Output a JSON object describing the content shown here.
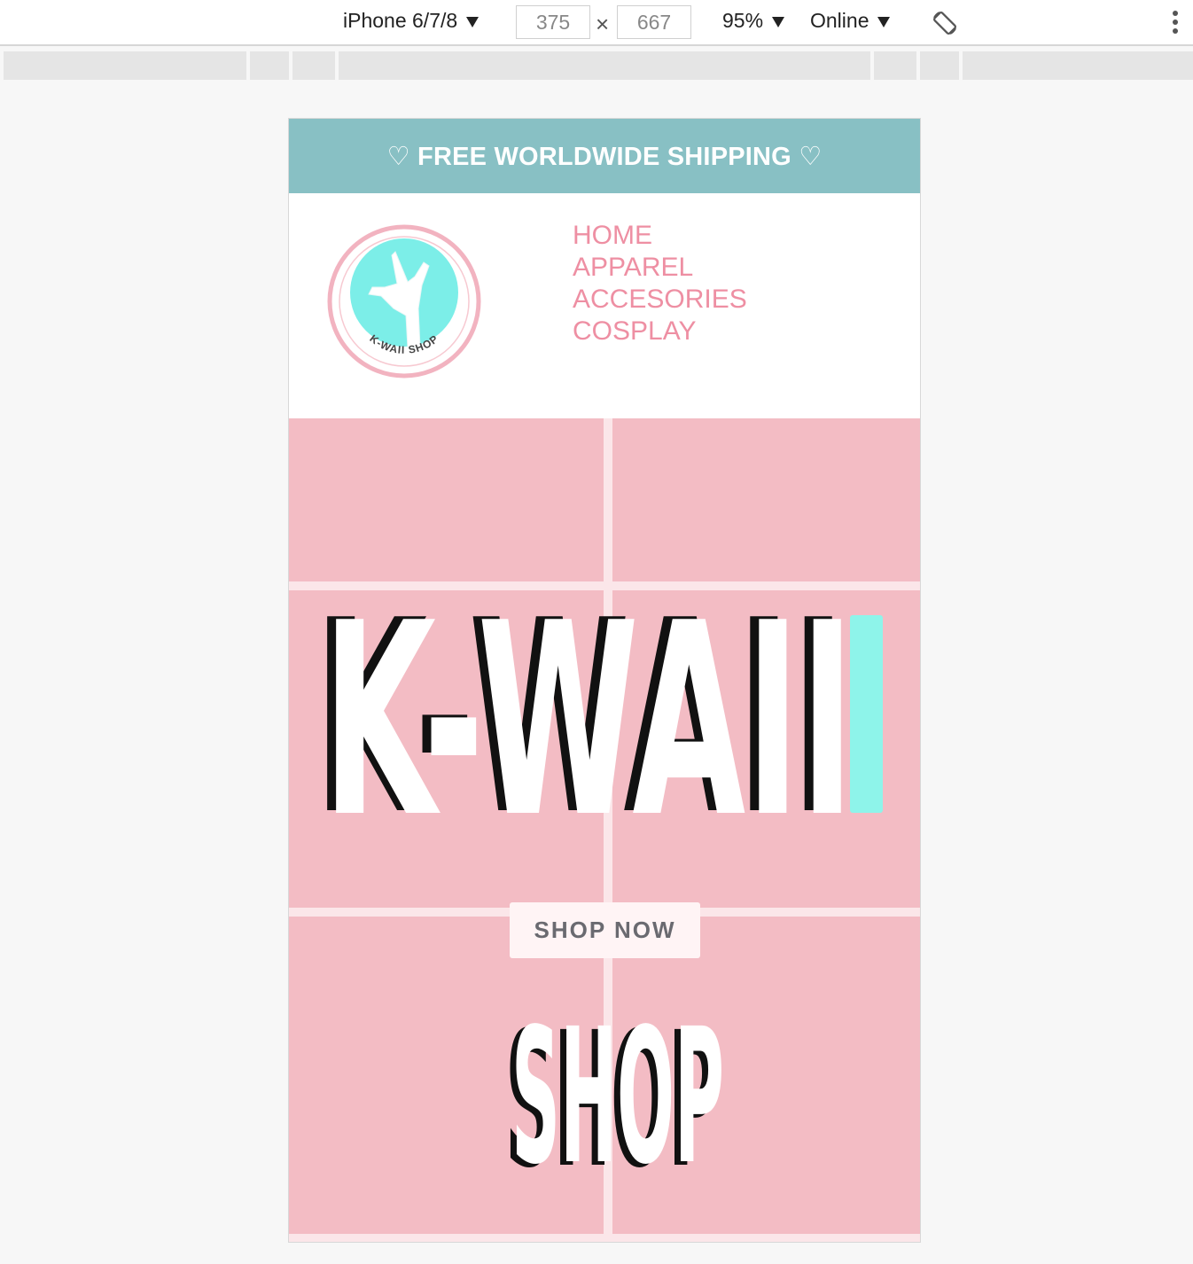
{
  "devtools": {
    "device": "iPhone 6/7/8",
    "width": "375",
    "height": "667",
    "times": "×",
    "zoom": "95%",
    "network": "Online"
  },
  "site": {
    "banner": "♡ FREE WORLDWIDE SHIPPING ♡",
    "logo_text": "K-WAII SHOP",
    "nav": [
      "HOME",
      "APPAREL",
      "ACCESORIES",
      "COSPLAY"
    ],
    "hero_title": "K-WAII",
    "hero_subtitle": "SHOP",
    "cta": "SHOP NOW"
  },
  "colors": {
    "banner": "#88c0c4",
    "nav_text": "#ee8fa3",
    "hero_bg": "#f3bcc4",
    "accent_mint": "#8ef4ea",
    "logo_ring": "#f2b3c0"
  }
}
